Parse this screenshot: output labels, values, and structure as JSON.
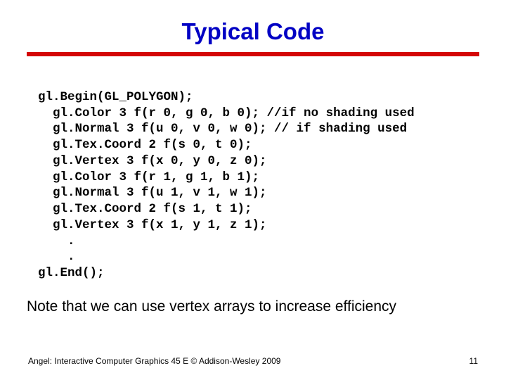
{
  "title": "Typical Code",
  "code_lines": [
    "gl.Begin(GL_POLYGON);",
    "  gl.Color 3 f(r 0, g 0, b 0); //if no shading used",
    "  gl.Normal 3 f(u 0, v 0, w 0); // if shading used",
    "  gl.Tex.Coord 2 f(s 0, t 0);",
    "  gl.Vertex 3 f(x 0, y 0, z 0);",
    "  gl.Color 3 f(r 1, g 1, b 1);",
    "  gl.Normal 3 f(u 1, v 1, w 1);",
    "  gl.Tex.Coord 2 f(s 1, t 1);",
    "  gl.Vertex 3 f(x 1, y 1, z 1);",
    "    .",
    "    .",
    "gl.End();"
  ],
  "note": "Note that we can use vertex arrays to increase efficiency",
  "footer": "Angel: Interactive Computer Graphics 45 E © Addison-Wesley 2009",
  "page_number": "11"
}
